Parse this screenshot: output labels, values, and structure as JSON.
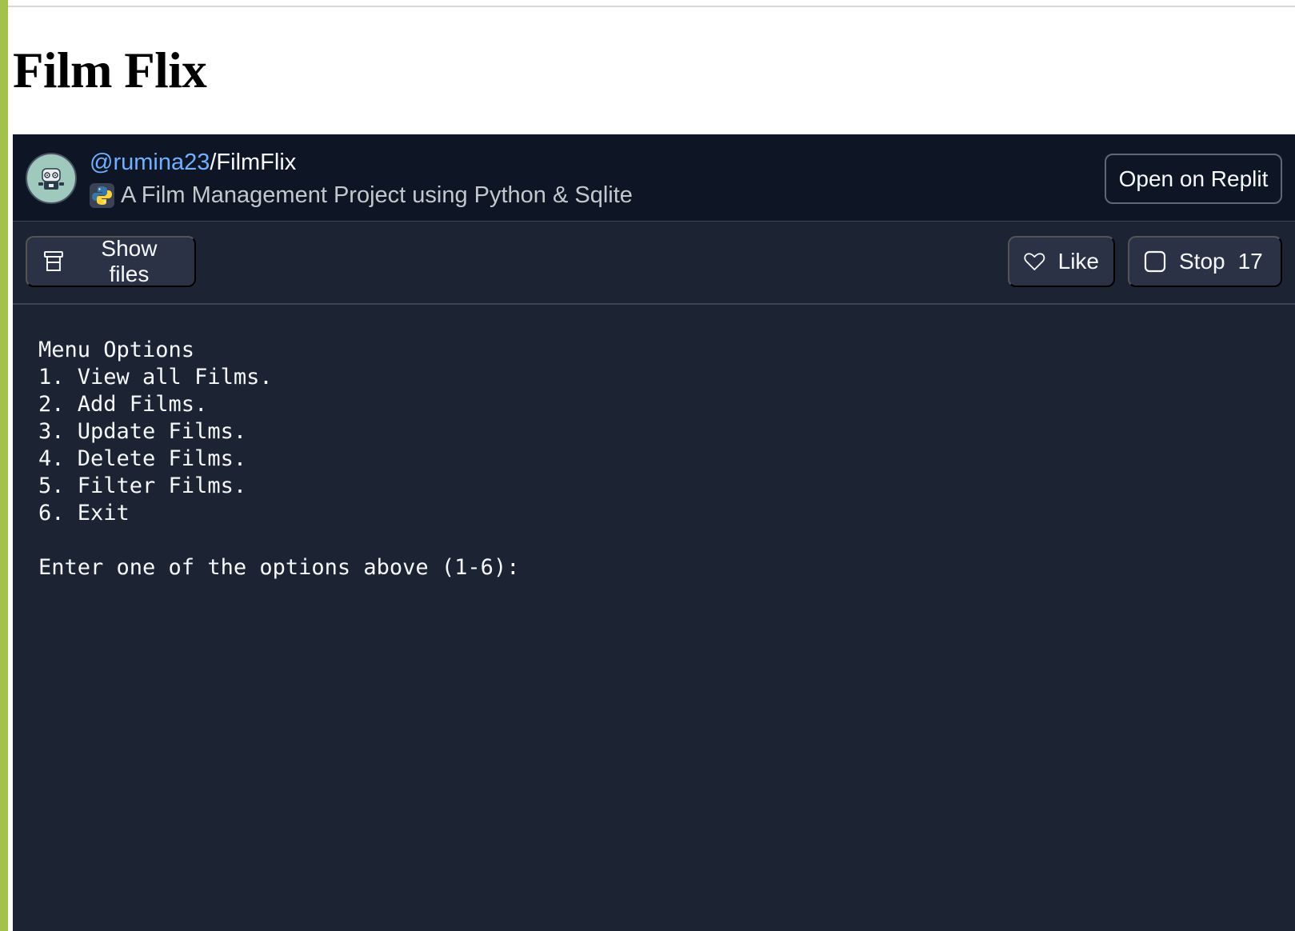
{
  "page": {
    "title": "Film Flix",
    "accent_color": "#a3c24d"
  },
  "repl": {
    "owner": "@rumina23",
    "separator": "/",
    "name": "FilmFlix",
    "description": "A Film Management Project using Python & Sqlite",
    "description_icon": "python-icon",
    "avatar_icon": "robot-avatar-icon",
    "open_label": "Open on Replit",
    "colors": {
      "header_bg": "#0e1525",
      "body_bg": "#1c2333",
      "button_bg": "#2b3245",
      "link": "#6fb0ff"
    }
  },
  "toolbar": {
    "show_files_label": "Show files",
    "show_files_icon": "files-icon",
    "like_label": "Like",
    "like_icon": "heart-icon",
    "stop_label": "Stop",
    "stop_icon": "stop-square-icon",
    "stop_count": "17"
  },
  "console": {
    "lines": [
      "Menu Options",
      "1. View all Films.",
      "2. Add Films.",
      "3. Update Films.",
      "4. Delete Films.",
      "5. Filter Films.",
      "6. Exit",
      "",
      "Enter one of the options above (1-6):"
    ]
  }
}
